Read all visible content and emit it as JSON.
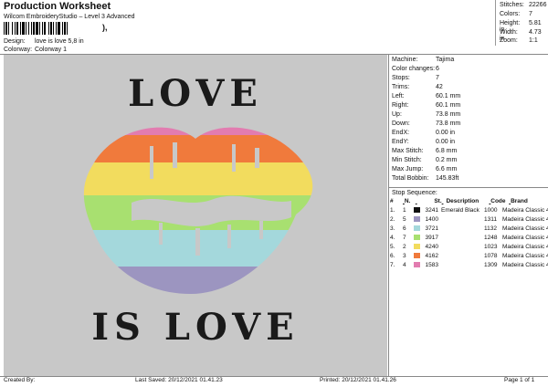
{
  "header": {
    "title": "Production Worksheet",
    "subtitle": "Wilcom EmbroideryStudio – Level 3 Advanced",
    "barcode_suffix": "),"
  },
  "design_meta": [
    {
      "label": "Design:",
      "value": "love is love 5,8 in"
    },
    {
      "label": "Colorway:",
      "value": "Colorway 1"
    }
  ],
  "summary": [
    {
      "label": "Stitches:",
      "value": "22266"
    },
    {
      "label": "Colors:",
      "value": "7"
    },
    {
      "label": "Height:",
      "value": "5.81 in"
    },
    {
      "label": "Width:",
      "value": "4.73 in"
    },
    {
      "label": "Zoom:",
      "value": "1:1"
    }
  ],
  "design": {
    "text_top": "LOVE",
    "text_bottom": "IS LOVE",
    "background_color": "#c8c8c8",
    "text_color": "#1a1a1a"
  },
  "machine_info": [
    {
      "label": "Machine:",
      "value": "Tajima"
    },
    {
      "label": "Color changes:",
      "value": "6"
    },
    {
      "label": "Stops:",
      "value": "7"
    },
    {
      "label": "Trims:",
      "value": "42"
    },
    {
      "label": "Left:",
      "value": "60.1 mm"
    },
    {
      "label": "Right:",
      "value": "60.1 mm"
    },
    {
      "label": "Up:",
      "value": "73.8 mm"
    },
    {
      "label": "Down:",
      "value": "73.8 mm"
    },
    {
      "label": "EndX:",
      "value": "0.00 in"
    },
    {
      "label": "EndY:",
      "value": "0.00 in"
    },
    {
      "label": "Max Stitch:",
      "value": "6.8 mm"
    },
    {
      "label": "Min Stitch:",
      "value": "0.2 mm"
    },
    {
      "label": "Max Jump:",
      "value": "6.6 mm"
    },
    {
      "label": "Total Bobbin:",
      "value": "145.83ft"
    }
  ],
  "stop_sequence": {
    "title": "Stop Sequence:",
    "columns": [
      "#",
      "N.",
      "St.",
      "Description",
      "Code",
      "Brand"
    ],
    "rows": [
      {
        "num": "1.",
        "needle": "1",
        "stitches": "3241",
        "description": "Emerald Black",
        "code": "1000",
        "brand": "Madeira Classic 40",
        "color": "#111111"
      },
      {
        "num": "2.",
        "needle": "5",
        "stitches": "1400",
        "description": "",
        "code": "1311",
        "brand": "Madeira Classic 40",
        "color": "#9c95c0"
      },
      {
        "num": "3.",
        "needle": "6",
        "stitches": "3721",
        "description": "",
        "code": "1132",
        "brand": "Madeira Classic 40",
        "color": "#a4d8dc"
      },
      {
        "num": "4.",
        "needle": "7",
        "stitches": "3917",
        "description": "",
        "code": "1248",
        "brand": "Madeira Classic 40",
        "color": "#a8e070"
      },
      {
        "num": "5.",
        "needle": "2",
        "stitches": "4240",
        "description": "",
        "code": "1023",
        "brand": "Madeira Classic 40",
        "color": "#f2dc5e"
      },
      {
        "num": "6.",
        "needle": "3",
        "stitches": "4162",
        "description": "",
        "code": "1078",
        "brand": "Madeira Classic 40",
        "color": "#f07a3c"
      },
      {
        "num": "7.",
        "needle": "4",
        "stitches": "1583",
        "description": "",
        "code": "1309",
        "brand": "Madeira Classic 40",
        "color": "#e27cb0"
      }
    ]
  },
  "footer": {
    "created_by": "Created By:",
    "last_saved": "Last Saved: 20/12/2021 01.41.23",
    "printed": "Printed: 20/12/2021 01.41.26",
    "page": "Page 1 of 1"
  }
}
